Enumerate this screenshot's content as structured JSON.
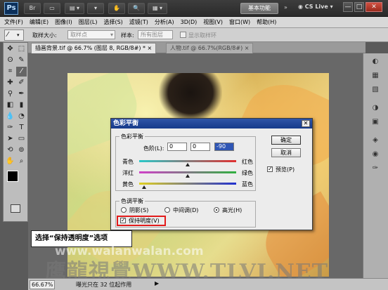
{
  "app": {
    "logo": "Ps",
    "workspace_button": "基本功能",
    "cs_live": "CS Live"
  },
  "window_controls": [
    "—",
    "□",
    "✕"
  ],
  "menu": [
    "文件(F)",
    "编辑(E)",
    "图像(I)",
    "图层(L)",
    "选择(S)",
    "滤镜(T)",
    "分析(A)",
    "3D(D)",
    "视图(V)",
    "窗口(W)",
    "帮助(H)"
  ],
  "options": {
    "sample_size_label": "取样大小:",
    "sample_size_value": "取样点",
    "sample_label": "样本:",
    "sample_value": "所有图层",
    "show_ring_label": "显示取样环"
  },
  "tabs": [
    {
      "label": "插画背景.tif @ 66.7% (图层 8, RGB/8#) *",
      "active": true
    },
    {
      "label": "人物.tif @ 66.7%(RGB/8#)",
      "active": false
    }
  ],
  "tab_close": "×",
  "dialog": {
    "title": "色彩平衡",
    "close": "✕",
    "color_balance_group": "色彩平衡",
    "levels_label": "色阶(L):",
    "levels": [
      "0",
      "0",
      "-90"
    ],
    "sliders": [
      {
        "left": "青色",
        "right": "红色",
        "position": 0.5
      },
      {
        "left": "洋红",
        "right": "绿色",
        "position": 0.5
      },
      {
        "left": "黄色",
        "right": "蓝色",
        "position": 0.05
      }
    ],
    "tone_group": "色调平衡",
    "tones": [
      {
        "label": "阴影(S)",
        "checked": false
      },
      {
        "label": "中间调(D)",
        "checked": false
      },
      {
        "label": "高光(H)",
        "checked": true
      }
    ],
    "preserve_label": "保持明度(V)",
    "preserve_checked": true,
    "ok_button": "确定",
    "cancel_button": "取消",
    "preview_label": "预览(P)",
    "preview_checked": true
  },
  "callout": "选择“保持透明度”选项",
  "watermarks": [
    "www.walanwalan.com",
    "鹰龍視覺WWW.TLVI.NET"
  ],
  "status": {
    "zoom": "66.67%",
    "text": "曝光只在 32 位起作用",
    "arrow": "▶"
  }
}
